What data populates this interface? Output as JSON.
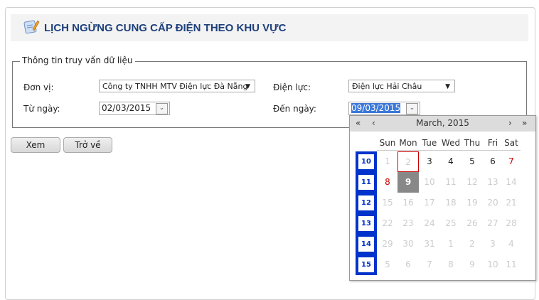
{
  "header": {
    "title": "LỊCH NGỪNG CUNG CẤP ĐIỆN THEO KHU VỰC",
    "icon": "document-edit-icon"
  },
  "form": {
    "legend": "Thông tin truy vấn dữ liệu",
    "don_vi_label": "Đơn vị:",
    "don_vi_value": "Công ty TNHH MTV Điện lực Đà Nẵng",
    "dien_luc_label": "Điện lực:",
    "dien_luc_value": "Điện lực Hải Châu",
    "tu_ngay_label": "Từ ngày:",
    "tu_ngay_value": "02/03/2015",
    "den_ngay_label": "Đến ngày:",
    "den_ngay_value": "09/03/2015"
  },
  "buttons": {
    "view": "Xem",
    "back": "Trở về"
  },
  "calendar": {
    "month_label": "March, 2015",
    "nav": {
      "prev_year": "«",
      "prev_month": "‹",
      "next_month": "›",
      "next_year": "»"
    },
    "weekdays": [
      "Sun",
      "Mon",
      "Tue",
      "Wed",
      "Thu",
      "Fri",
      "Sat"
    ],
    "weeks": [
      {
        "num": "10",
        "days": [
          "1",
          "2",
          "3",
          "4",
          "5",
          "6",
          "7"
        ]
      },
      {
        "num": "11",
        "days": [
          "8",
          "9",
          "10",
          "11",
          "12",
          "13",
          "14"
        ]
      },
      {
        "num": "12",
        "days": [
          "15",
          "16",
          "17",
          "18",
          "19",
          "20",
          "21"
        ]
      },
      {
        "num": "13",
        "days": [
          "22",
          "23",
          "24",
          "25",
          "26",
          "27",
          "28"
        ]
      },
      {
        "num": "14",
        "days": [
          "29",
          "30",
          "31",
          "1",
          "2",
          "3",
          "4"
        ]
      },
      {
        "num": "15",
        "days": [
          "5",
          "6",
          "7",
          "8",
          "9",
          "10",
          "11"
        ]
      }
    ],
    "enabled_days": [
      "3",
      "4",
      "5",
      "6",
      "7",
      "8",
      "9"
    ],
    "weekend_color": "#cc0000",
    "today": "2",
    "selected": "9",
    "colors": {
      "accent": "#0033cc",
      "selected_bg": "#888888",
      "disabled": "#cccccc"
    }
  }
}
